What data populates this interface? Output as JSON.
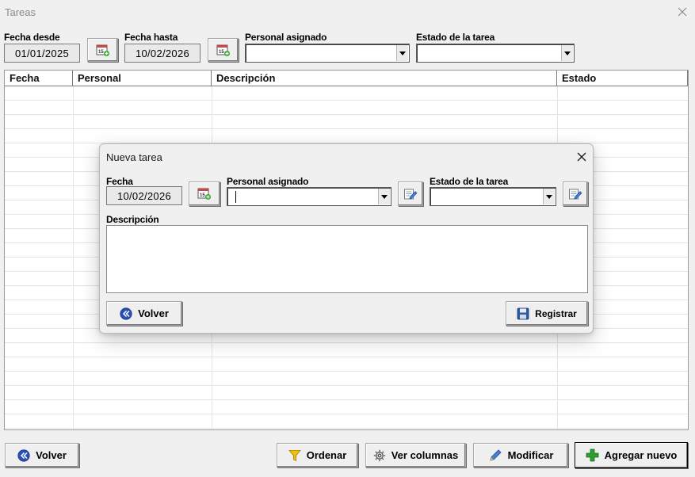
{
  "window": {
    "title": "Tareas"
  },
  "filters": {
    "fecha_desde": {
      "label": "Fecha desde",
      "value": "01/01/2025"
    },
    "fecha_hasta": {
      "label": "Fecha hasta",
      "value": "10/02/2026"
    },
    "personal": {
      "label": "Personal asignado",
      "value": ""
    },
    "estado": {
      "label": "Estado de la tarea",
      "value": ""
    }
  },
  "table": {
    "columns": [
      "Fecha",
      "Personal",
      "Descripción",
      "Estado"
    ],
    "rows": []
  },
  "dialog": {
    "title": "Nueva tarea",
    "fecha": {
      "label": "Fecha",
      "value": "10/02/2026"
    },
    "personal": {
      "label": "Personal asignado",
      "value": ""
    },
    "estado": {
      "label": "Estado de la tarea",
      "value": ""
    },
    "descripcion": {
      "label": "Descripción",
      "value": ""
    },
    "volver_label": "Volver",
    "registrar_label": "Registrar"
  },
  "footer": {
    "volver_label": "Volver",
    "ordenar_label": "Ordenar",
    "ver_columnas_label": "Ver columnas",
    "modificar_label": "Modificar",
    "agregar_label": "Agregar nuevo"
  },
  "colors": {
    "window_bg": "#f0f0f0",
    "accent_blue": "#2a4fb8",
    "add_green": "#2e9e2e",
    "filter_yellow": "#f2c200"
  }
}
